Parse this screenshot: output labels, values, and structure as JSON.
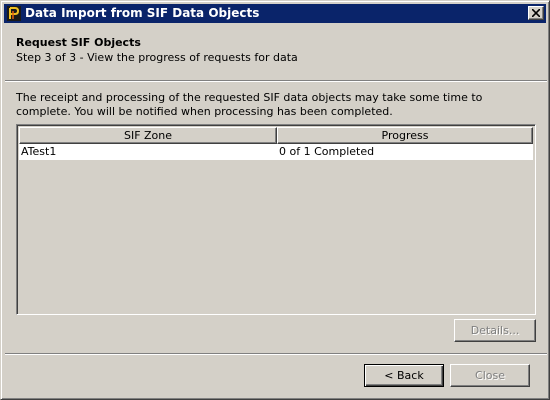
{
  "window": {
    "title": "Data Import from SIF Data Objects"
  },
  "header": {
    "title": "Request SIF Objects",
    "subtitle": "Step 3 of 3 - View the progress of requests for data"
  },
  "description": "The receipt and processing of the requested SIF data objects may take some time to complete. You will be notified when processing has been completed.",
  "table": {
    "columns": [
      "SIF Zone",
      "Progress"
    ],
    "rows": [
      {
        "zone": "ATest1",
        "progress": "0 of 1 Completed"
      }
    ]
  },
  "buttons": {
    "details": "Details...",
    "back": "< Back",
    "close": "Close"
  },
  "colors": {
    "titlebar": "#0a246a",
    "face": "#d4d0c8"
  }
}
